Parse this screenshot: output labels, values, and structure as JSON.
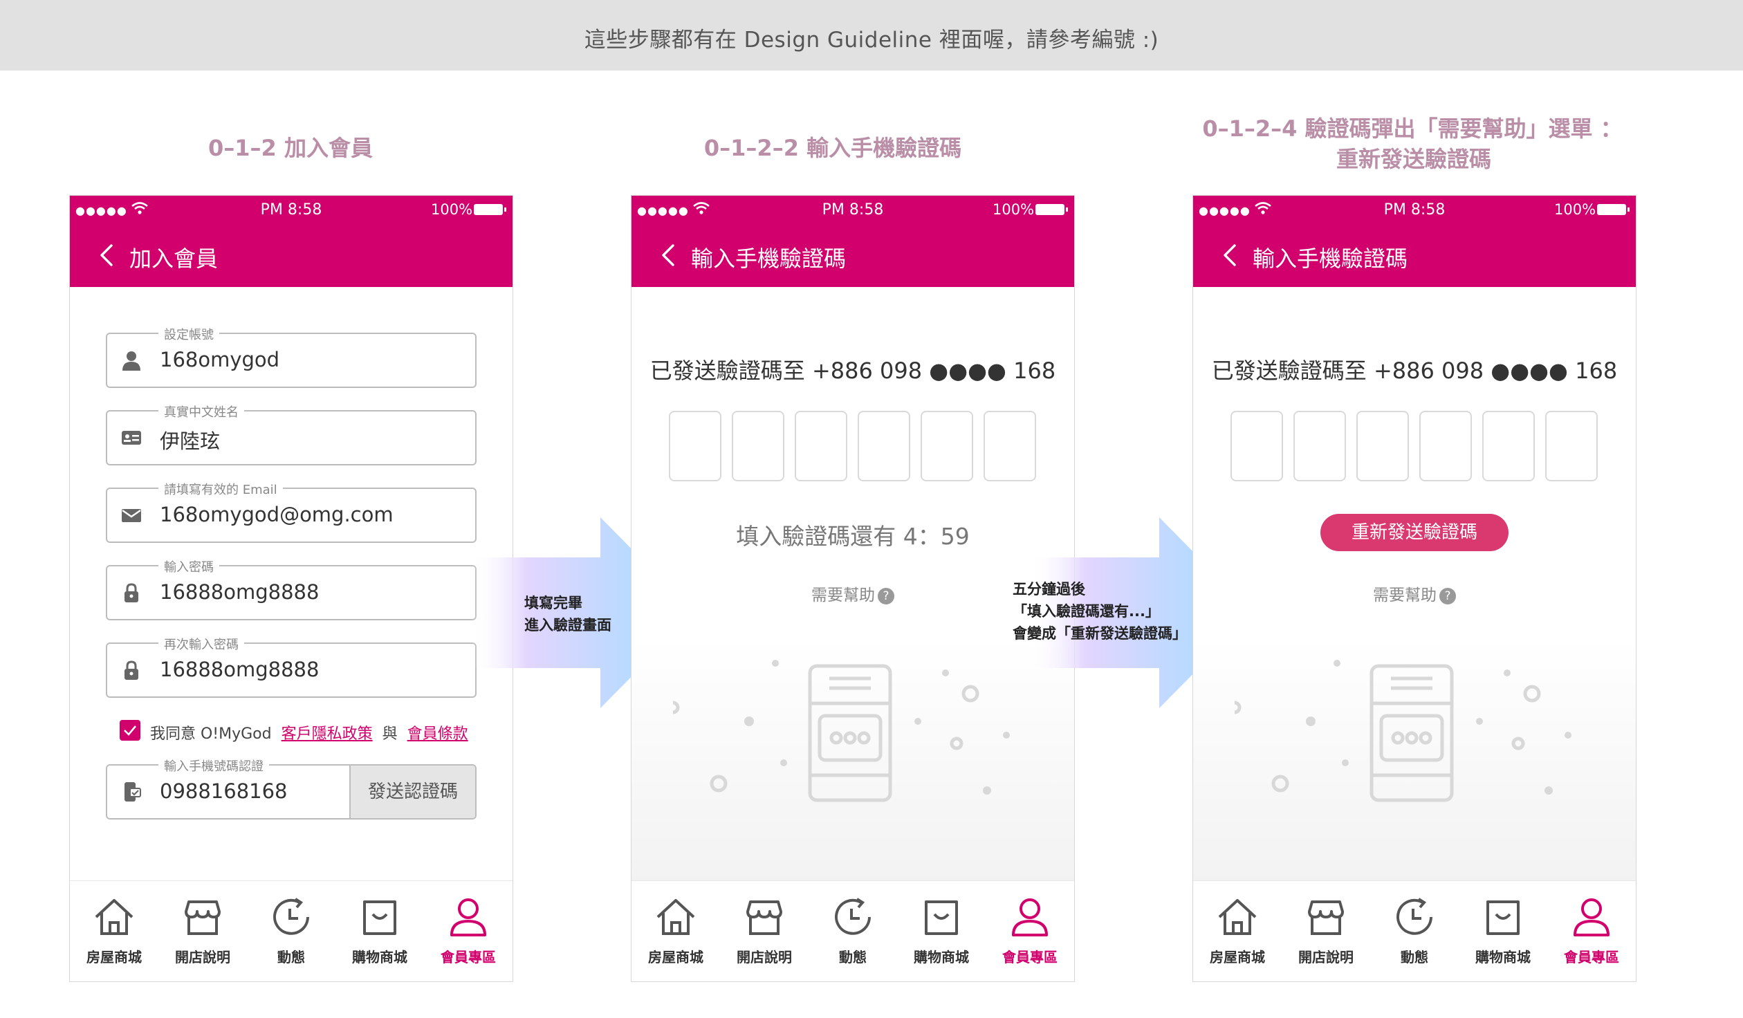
{
  "banner": {
    "text": "這些步驟都有在 Design Guideline 裡面喔，請參考編號 :)"
  },
  "steps": [
    {
      "title": "0–1–2 加入會員"
    },
    {
      "title": "0–1–2–2 輸入手機驗證碼"
    },
    {
      "title_line1": "0–1–2–4 驗證碼彈出「需要幫助」選單 ：",
      "title_line2": "重新發送驗證碼"
    }
  ],
  "status_bar": {
    "signal": "●●●●●",
    "time": "PM 8:58",
    "battery": "100%"
  },
  "screen1": {
    "nav_title": "加入會員",
    "fields": [
      {
        "label": "設定帳號",
        "value": "168omygod",
        "icon": "user-icon"
      },
      {
        "label": "真實中文姓名",
        "value": "伊陸玹",
        "icon": "id-card-icon"
      },
      {
        "label": "請填寫有效的 Email",
        "value": "168omygod@omg.com",
        "icon": "mail-icon"
      },
      {
        "label": "輸入密碼",
        "value": "16888omg8888",
        "icon": "lock-icon"
      },
      {
        "label": "再次輸入密碼",
        "value": "16888omg8888",
        "icon": "lock-icon"
      }
    ],
    "agree": {
      "prefix": "我同意 O!MyGod",
      "privacy": "客戶隱私政策",
      "and": "與",
      "terms": "會員條款"
    },
    "phone_field": {
      "label": "輸入手機號碼認證",
      "value": "0988168168",
      "button": "發送認證碼"
    }
  },
  "screen2": {
    "nav_title": "輸入手機驗證碼",
    "sent_text": "已發送驗證碼至 +886 098 ●●●● 168",
    "timer": "填入驗證碼還有 4：59",
    "help": "需要幫助"
  },
  "screen3": {
    "nav_title": "輸入手機驗證碼",
    "sent_text": "已發送驗證碼至 +886 098 ●●●● 168",
    "resend": "重新發送驗證碼",
    "help": "需要幫助"
  },
  "arrow1": {
    "line1": "填寫完畢",
    "line2": "進入驗證畫面"
  },
  "arrow2": {
    "line1": "五分鐘過後",
    "line2": "「填入驗證碼還有...」",
    "line3": "會變成「重新發送驗證碼」"
  },
  "tabbar": {
    "items": [
      {
        "label": "房屋商城",
        "icon": "house-icon"
      },
      {
        "label": "開店說明",
        "icon": "store-icon"
      },
      {
        "label": "動態",
        "icon": "clock-icon"
      },
      {
        "label": "購物商城",
        "icon": "bag-icon"
      },
      {
        "label": "會員專區",
        "icon": "member-icon"
      }
    ],
    "active_color": "#d1006c"
  },
  "colors": {
    "brand": "#d1006c",
    "resend": "#d9396e",
    "title": "#b98ea6"
  }
}
